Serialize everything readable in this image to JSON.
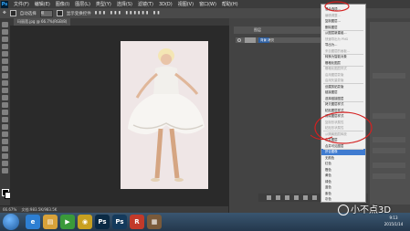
{
  "app": {
    "logo": "Ps"
  },
  "menubar": {
    "items": [
      "文件(F)",
      "编辑(E)",
      "图像(I)",
      "图层(L)",
      "类型(Y)",
      "选择(S)",
      "滤镜(T)",
      "3D(D)",
      "视图(V)",
      "窗口(W)",
      "帮助(H)"
    ]
  },
  "options": {
    "mode_label": "自动选择",
    "target": "组",
    "show_transform": "显示变换控件"
  },
  "document": {
    "tab_title": "玛丽莲.jpg @ 66.7%(RGB/8)",
    "zoom": "66.67%",
    "doc_info": "文档:983.5K/983.5K"
  },
  "layers": {
    "tab_label": "图层",
    "layer_name": "背景 拷贝"
  },
  "context_menu": {
    "items": [
      {
        "label": "混合选项...",
        "state": "normal"
      },
      {
        "label": "编辑调整...",
        "state": "disabled"
      },
      {
        "label": "复制图层...",
        "state": "normal"
      },
      {
        "label": "删除图层",
        "state": "normal"
      },
      {
        "label": "从图层新建组...",
        "state": "normal"
      },
      {
        "label": "快速导出为 PNG",
        "state": "disabled"
      },
      {
        "label": "导出为...",
        "state": "normal"
      },
      {
        "label": "来自图层的画板...",
        "state": "disabled"
      },
      {
        "label": "转换为智能对象",
        "state": "normal"
      },
      {
        "label": "栅格化图层",
        "state": "normal"
      },
      {
        "label": "栅格化图层样式",
        "state": "disabled"
      },
      {
        "label": "启用图层蒙版",
        "state": "disabled"
      },
      {
        "label": "启用矢量蒙版",
        "state": "disabled"
      },
      {
        "label": "创建剪贴蒙版",
        "state": "normal"
      },
      {
        "label": "链接图层",
        "state": "normal"
      },
      {
        "label": "选择链接图层",
        "state": "normal"
      },
      {
        "label": "拷贝图层样式",
        "state": "normal"
      },
      {
        "label": "粘贴图层样式",
        "state": "normal"
      },
      {
        "label": "清除图层样式",
        "state": "normal"
      },
      {
        "label": "复制形状属性",
        "state": "disabled"
      },
      {
        "label": "粘贴形状属性",
        "state": "disabled"
      },
      {
        "label": "从隔离图层释放",
        "state": "disabled"
      },
      {
        "label": "合并图层",
        "state": "normal"
      },
      {
        "label": "合并可见图层",
        "state": "normal"
      },
      {
        "label": "拼合图像",
        "state": "highlighted"
      },
      {
        "label": "无颜色",
        "state": "normal"
      },
      {
        "label": "红色",
        "state": "normal"
      },
      {
        "label": "橙色",
        "state": "normal"
      },
      {
        "label": "黄色",
        "state": "normal"
      },
      {
        "label": "绿色",
        "state": "normal"
      },
      {
        "label": "蓝色",
        "state": "normal"
      },
      {
        "label": "紫色",
        "state": "normal"
      },
      {
        "label": "灰色",
        "state": "normal"
      }
    ]
  },
  "taskbar": {
    "apps": [
      {
        "icon": "ie-icon",
        "glyph": "e",
        "color": "#2d7fd3"
      },
      {
        "icon": "explorer-icon",
        "glyph": "▤",
        "color": "#d8a23a"
      },
      {
        "icon": "media-player-icon",
        "glyph": "▶",
        "color": "#3a9a3a"
      },
      {
        "icon": "chrome-icon",
        "glyph": "◉",
        "color": "#c8a020"
      },
      {
        "icon": "photoshop-icon",
        "glyph": "Ps",
        "color": "#0a2a44"
      },
      {
        "icon": "ps-active-icon",
        "glyph": "Ps",
        "color": "#143a5c"
      },
      {
        "icon": "red-app-icon",
        "glyph": "R",
        "color": "#c23a2a"
      },
      {
        "icon": "file-icon",
        "glyph": "▦",
        "color": "#7a5a3a"
      }
    ],
    "time": "9:13",
    "date": "2015/1/14"
  },
  "watermark": {
    "text": "小不点3D"
  },
  "colors": {
    "accent": "#3f7bd0",
    "annotation": "#d42020"
  }
}
